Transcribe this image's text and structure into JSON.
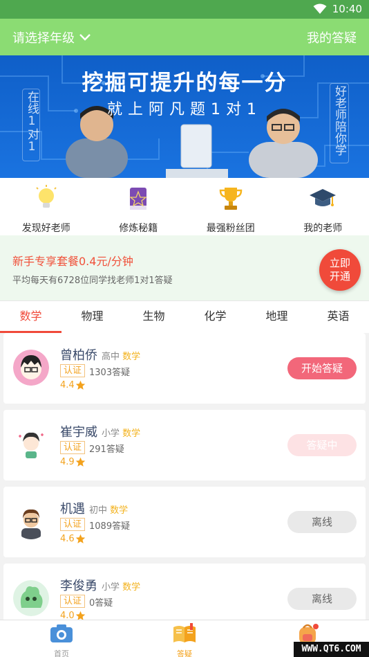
{
  "status_bar": {
    "time": "10:40"
  },
  "header": {
    "grade_select": "请选择年级",
    "my_questions": "我的答疑"
  },
  "banner": {
    "headline": "挖掘可提升的每一分",
    "subline": "就上阿凡题1对1",
    "left_vertical": "在线1对1",
    "right_vertical": "好老师陪你学"
  },
  "quick_links": [
    {
      "label": "发现好老师",
      "icon": "lightbulb-icon"
    },
    {
      "label": "修炼秘籍",
      "icon": "spellbook-icon"
    },
    {
      "label": "最强粉丝团",
      "icon": "trophy-icon"
    },
    {
      "label": "我的老师",
      "icon": "graduation-cap-icon"
    }
  ],
  "promo": {
    "title": "新手专享套餐0.4元/分钟",
    "subtitle": "平均每天有6728位同学找老师1对1答疑",
    "cta": "立即开通"
  },
  "tabs": [
    "数学",
    "物理",
    "生物",
    "化学",
    "地理",
    "英语"
  ],
  "active_tab": 0,
  "teachers": [
    {
      "name": "曾柏侨",
      "level": "高中",
      "subject": "数学",
      "cert": "认证",
      "answers": "1303答疑",
      "rating": "4.4",
      "button": "开始答疑",
      "state": "start"
    },
    {
      "name": "崔宇威",
      "level": "小学",
      "subject": "数学",
      "cert": "认证",
      "answers": "291答疑",
      "rating": "4.9",
      "button": "答疑中",
      "state": "busy"
    },
    {
      "name": "机遇",
      "level": "初中",
      "subject": "数学",
      "cert": "认证",
      "answers": "1089答疑",
      "rating": "4.6",
      "button": "离线",
      "state": "offline"
    },
    {
      "name": "李俊勇",
      "level": "小学",
      "subject": "数学",
      "cert": "认证",
      "answers": "0答疑",
      "rating": "4.0",
      "button": "离线",
      "state": "offline"
    }
  ],
  "bottom_nav": [
    {
      "label": "首页",
      "icon": "camera-icon"
    },
    {
      "label": "答疑",
      "icon": "open-book-icon"
    },
    {
      "label": "",
      "icon": "schoolbag-icon"
    }
  ],
  "watermark": "WWW.QT6.COM",
  "colors": {
    "header": "#8bdc73",
    "accent": "#f04a3a",
    "star": "#f3a21d",
    "banner": "#1a73e0"
  }
}
